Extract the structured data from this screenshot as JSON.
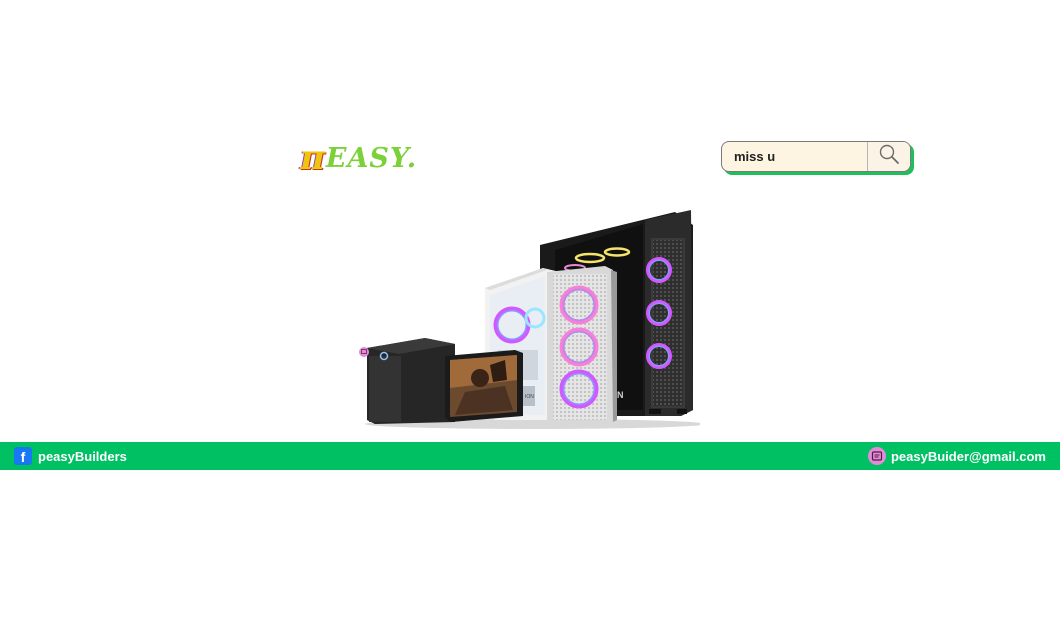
{
  "header": {
    "logo": {
      "glyph": "π",
      "text": "EASY.",
      "colors": {
        "pi": "#f1c40f",
        "text": "#7cd038"
      }
    },
    "search": {
      "value": "miss u",
      "button_icon": "search-icon",
      "shadow_color": "#1fbf5a",
      "background": "#fdf4e1"
    }
  },
  "main": {
    "hero_image": {
      "icon": "pc-cases-product-image"
    }
  },
  "footer": {
    "background": "#00c064",
    "facebook": {
      "icon": "facebook-icon",
      "label": "peasyBuilders"
    },
    "email": {
      "icon": "email-icon",
      "label": "peasyBuider@gmail.com"
    }
  }
}
